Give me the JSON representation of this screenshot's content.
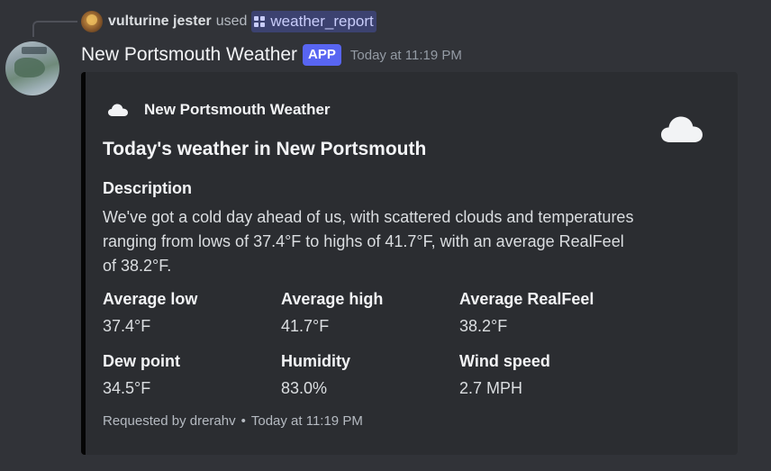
{
  "reply": {
    "username": "vulturine jester",
    "used_text": "used",
    "command": "weather_report"
  },
  "message": {
    "author": "New Portsmouth Weather",
    "tag": "APP",
    "timestamp": "Today at 11:19 PM"
  },
  "embed": {
    "color": "#050505",
    "author_name": "New Portsmouth Weather",
    "author_icon": "cloud-icon",
    "thumbnail_icon": "cloud-icon",
    "title": "Today's weather in New Portsmouth",
    "description": {
      "name": "Description",
      "value": "We've got a cold day ahead of us, with scattered clouds and temperatures ranging from lows of 37.4°F to highs of 41.7°F, with an average RealFeel of 38.2°F."
    },
    "fields": [
      {
        "name": "Average low",
        "value": "37.4°F"
      },
      {
        "name": "Average high",
        "value": "41.7°F"
      },
      {
        "name": "Average RealFeel",
        "value": "38.2°F"
      },
      {
        "name": "Dew point",
        "value": "34.5°F"
      },
      {
        "name": "Humidity",
        "value": "83.0%"
      },
      {
        "name": "Wind speed",
        "value": "2.7 MPH"
      }
    ],
    "footer": {
      "requested_by": "Requested by drerahv",
      "separator": "•",
      "time": "Today at 11:19 PM"
    }
  }
}
